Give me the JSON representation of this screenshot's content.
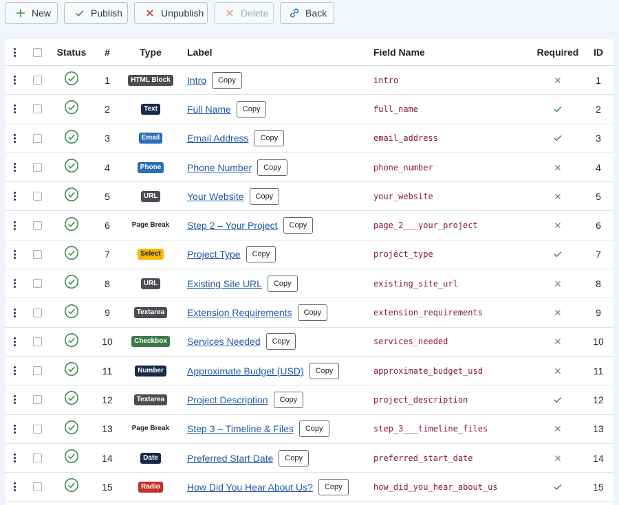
{
  "toolbar": {
    "new_label": "New",
    "publish_label": "Publish",
    "unpublish_label": "Unpublish",
    "delete_label": "Delete",
    "back_label": "Back"
  },
  "table": {
    "headers": {
      "status": "Status",
      "num": "#",
      "type": "Type",
      "label": "Label",
      "field_name": "Field Name",
      "required": "Required",
      "id": "ID"
    },
    "copy_label": "Copy",
    "rows": [
      {
        "num": "1",
        "type": "HTML Block",
        "type_color": "#4a4e53",
        "label": "Intro",
        "field": "intro",
        "required": false,
        "id": "1"
      },
      {
        "num": "2",
        "type": "Text",
        "type_color": "#16294a",
        "label": "Full Name",
        "field": "full_name",
        "required": true,
        "id": "2"
      },
      {
        "num": "3",
        "type": "Email",
        "type_color": "#2a6db8",
        "label": "Email Address",
        "field": "email_address",
        "required": true,
        "id": "3"
      },
      {
        "num": "4",
        "type": "Phone",
        "type_color": "#2a6db8",
        "label": "Phone Number",
        "field": "phone_number",
        "required": false,
        "id": "4"
      },
      {
        "num": "5",
        "type": "URL",
        "type_color": "#4a4e53",
        "label": "Your Website",
        "field": "your_website",
        "required": false,
        "id": "5"
      },
      {
        "num": "6",
        "type": "Page Break",
        "type_color": "",
        "label": "Step 2 – Your Project",
        "field": "page_2___your_project",
        "required": false,
        "id": "6"
      },
      {
        "num": "7",
        "type": "Select",
        "type_color": "#f5b70a",
        "label": "Project Type",
        "field": "project_type",
        "required": true,
        "id": "7"
      },
      {
        "num": "8",
        "type": "URL",
        "type_color": "#4a4e53",
        "label": "Existing Site URL",
        "field": "existing_site_url",
        "required": false,
        "id": "8"
      },
      {
        "num": "9",
        "type": "Textarea",
        "type_color": "#4a4e53",
        "label": "Extension Requirements",
        "field": "extension_requirements",
        "required": false,
        "id": "9"
      },
      {
        "num": "10",
        "type": "Checkbox",
        "type_color": "#3a7a48",
        "label": "Services Needed",
        "field": "services_needed",
        "required": false,
        "id": "10"
      },
      {
        "num": "11",
        "type": "Number",
        "type_color": "#16294a",
        "label": "Approximate Budget (USD)",
        "field": "approximate_budget_usd",
        "required": false,
        "id": "11"
      },
      {
        "num": "12",
        "type": "Textarea",
        "type_color": "#4a4e53",
        "label": "Project Description",
        "field": "project_description",
        "required": true,
        "id": "12"
      },
      {
        "num": "13",
        "type": "Page Break",
        "type_color": "",
        "label": "Step 3 – Timeline & Files",
        "field": "step_3___timeline_files",
        "required": false,
        "id": "13"
      },
      {
        "num": "14",
        "type": "Date",
        "type_color": "#16294a",
        "label": "Preferred Start Date",
        "field": "preferred_start_date",
        "required": false,
        "id": "14"
      },
      {
        "num": "15",
        "type": "Radio",
        "type_color": "#c5302a",
        "label": "How Did You Hear About Us?",
        "field": "how_did_you_hear_about_us",
        "required": true,
        "id": "15"
      }
    ]
  },
  "colors": {
    "published": "#3b8a55",
    "required_yes": "#3b8a55",
    "required_no": "#7b8188",
    "link": "#1f58a8",
    "field_name": "#8b1a35"
  },
  "icons": {
    "new": "plus-icon",
    "publish": "check-icon",
    "unpublish": "x-icon",
    "delete": "x-icon",
    "back": "link-icon",
    "status": "check-circle-icon",
    "drag": "drag-handle-icon"
  }
}
